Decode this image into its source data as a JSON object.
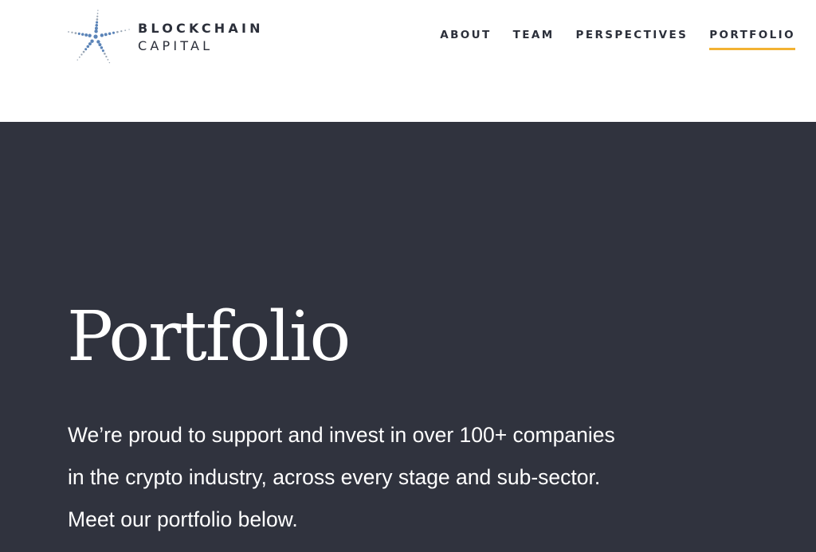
{
  "brand": {
    "line1": "BLOCKCHAIN",
    "line2": "CAPITAL",
    "logo_icon": "starburst-dots-logo",
    "colors": {
      "dots_primary": "#5b84b8",
      "dots_secondary": "#9aa6b4",
      "wordmark": "#2b2f3a"
    }
  },
  "nav": {
    "items": [
      {
        "label": "ABOUT",
        "active": false
      },
      {
        "label": "TEAM",
        "active": false
      },
      {
        "label": "PERSPECTIVES",
        "active": false
      },
      {
        "label": "PORTFOLIO",
        "active": true
      }
    ],
    "active_underline_color": "#f2b233"
  },
  "hero": {
    "title": "Portfolio",
    "intro": "We’re proud to support and invest in over 100+ companies in the crypto industry, across every stage and sub-sector. Meet our portfolio below.",
    "background": "#30333e",
    "text_color": "#ffffff"
  }
}
